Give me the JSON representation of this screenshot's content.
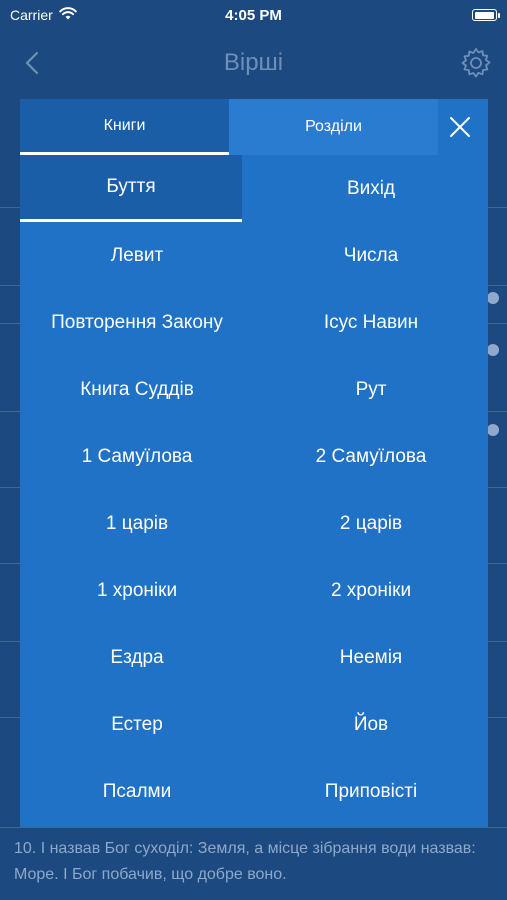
{
  "status_bar": {
    "carrier": "Carrier",
    "time": "4:05 PM"
  },
  "nav": {
    "title": "Вірші"
  },
  "background_verse": {
    "text": "10. І назвав Бог суходіл: Земля, а місце зібрання води назвав: Море. І Бог побачив, що добре воно."
  },
  "picker": {
    "tabs": {
      "books": "Книги",
      "chapters": "Розділи"
    },
    "books": [
      "Буття",
      "Вихід",
      "Левит",
      "Числа",
      "Повторення Закону",
      "Ісус Навин",
      "Книга Суддів",
      "Рут",
      "1 Самуїлова",
      "2 Самуїлова",
      "1 царів",
      "2 царів",
      "1 хроніки",
      "2 хроніки",
      "Ездра",
      "Неемія",
      "Естер",
      "Йов",
      "Псалми",
      "Приповісті"
    ],
    "selected_index": 0
  },
  "colors": {
    "background": "#1c4a80",
    "panel": "#1f72c6",
    "tab_active": "#1a5ea8"
  }
}
